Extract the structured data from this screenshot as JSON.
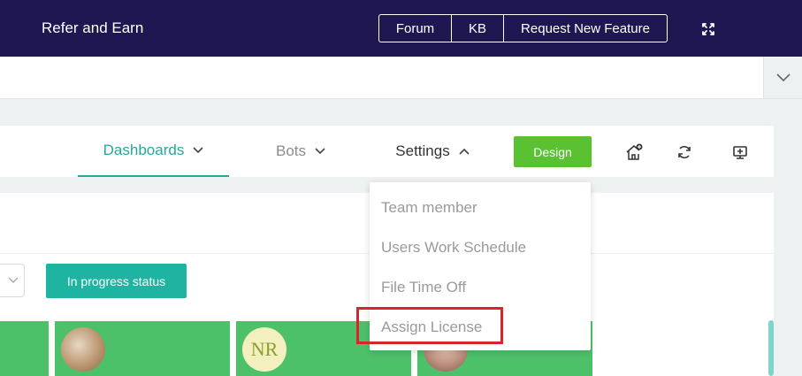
{
  "topbar": {
    "title": "Refer and Earn",
    "buttons": {
      "forum": "Forum",
      "kb": "KB",
      "request": "Request New Feature"
    },
    "expand_icon": "expand-icon"
  },
  "nav": {
    "dashboards": "Dashboards",
    "bots": "Bots",
    "settings": "Settings",
    "design": "Design",
    "icons": [
      "home-add-icon",
      "refresh-icon",
      "monitor-icon"
    ]
  },
  "content": {
    "in_progress_label": "In progress status",
    "tiles": [
      {
        "avatar_initials": ""
      },
      {
        "avatar_initials": ""
      },
      {
        "avatar_initials": "NR"
      },
      {
        "avatar_initials": ""
      }
    ]
  },
  "settings_menu": {
    "items": [
      "Team member",
      "Users Work Schedule",
      "File Time Off",
      "Assign License"
    ],
    "highlighted": "Assign License"
  },
  "colors": {
    "topbar": "#1e1752",
    "accent": "#23a89d",
    "design_button": "#59c132",
    "tile_green": "#4dc06a",
    "highlight": "#d9232d"
  }
}
